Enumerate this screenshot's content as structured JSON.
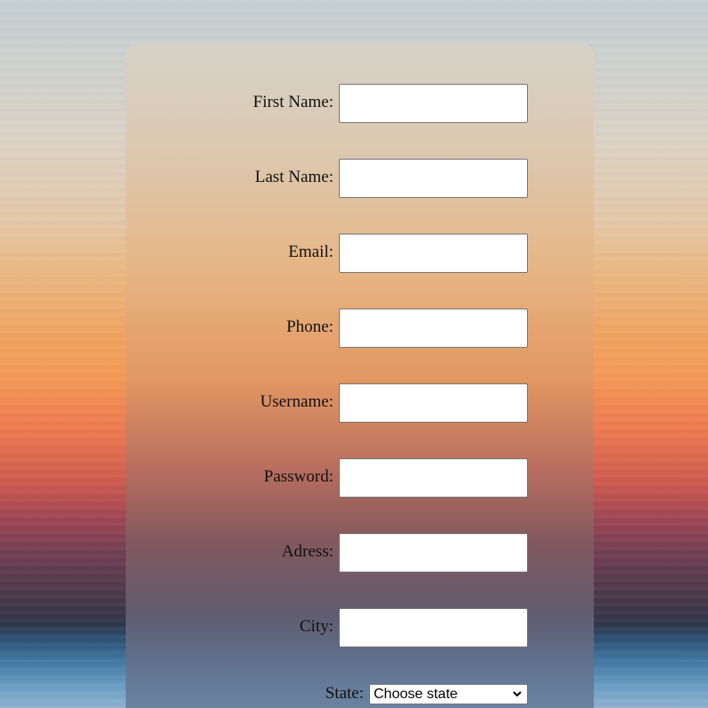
{
  "form": {
    "fields": [
      {
        "label": "First Name:",
        "value": "",
        "name": "first-name"
      },
      {
        "label": "Last Name:",
        "value": "",
        "name": "last-name"
      },
      {
        "label": "Email:",
        "value": "",
        "name": "email"
      },
      {
        "label": "Phone:",
        "value": "",
        "name": "phone"
      },
      {
        "label": "Username:",
        "value": "",
        "name": "username"
      },
      {
        "label": "Password:",
        "value": "",
        "name": "password"
      },
      {
        "label": "Adress:",
        "value": "",
        "name": "adress"
      },
      {
        "label": "City:",
        "value": "",
        "name": "city"
      }
    ],
    "state": {
      "label": "State:",
      "selected": "Choose state"
    }
  },
  "icons": {
    "state_dropdown": "chevron-down-icon"
  }
}
